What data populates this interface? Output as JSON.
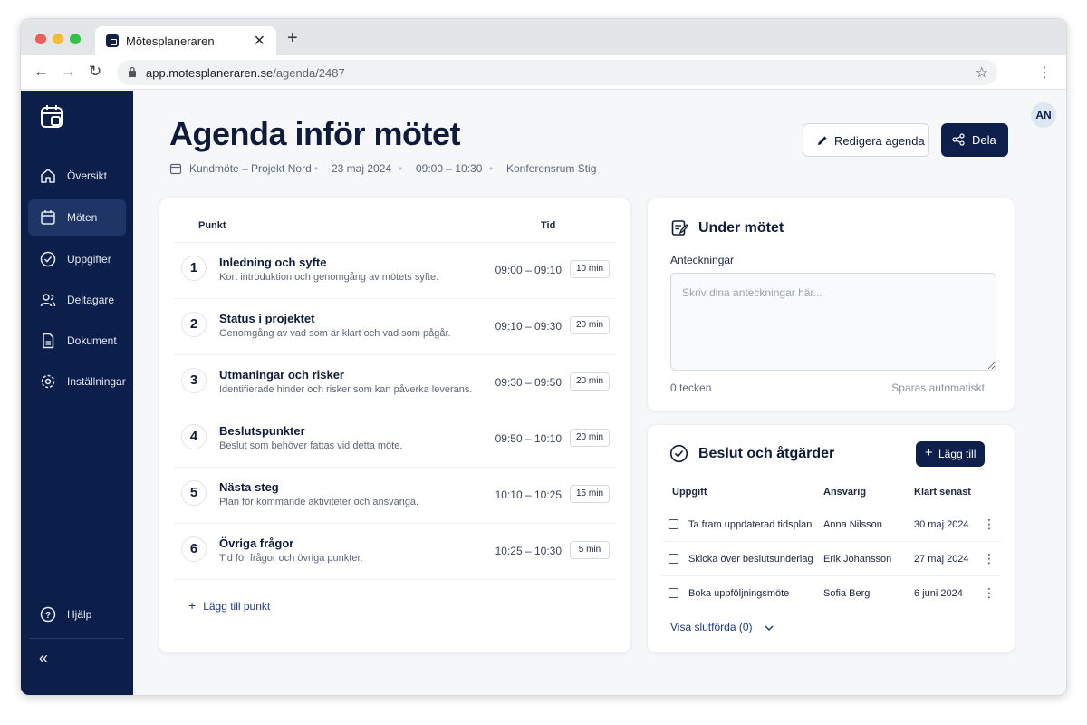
{
  "browser": {
    "tab_title": "Mötesplaneraren",
    "tab_close": "✕",
    "new_tab": "+",
    "back": "←",
    "forward": "→",
    "reload": "↻",
    "url_host": "app.motesplaneraren.se",
    "url_path": "/agenda/2487",
    "star": "☆",
    "menu": "⋮"
  },
  "sidebar": {
    "items": [
      {
        "label": "Översikt",
        "icon": "home-icon"
      },
      {
        "label": "Möten",
        "icon": "calendar-icon",
        "active": true
      },
      {
        "label": "Uppgifter",
        "icon": "check-circle-icon"
      },
      {
        "label": "Deltagare",
        "icon": "users-icon"
      },
      {
        "label": "Dokument",
        "icon": "document-icon"
      },
      {
        "label": "Inställningar",
        "icon": "gear-icon"
      }
    ],
    "help": "Hjälp",
    "collapse": "«"
  },
  "user": {
    "initials": "AN"
  },
  "header": {
    "title": "Agenda inför mötet",
    "meeting_name": "Kundmöte – Projekt Nord",
    "date": "23 maj 2024",
    "time": "09:00 – 10:30",
    "room": "Konferensrum Stig",
    "edit_label": "Redigera agenda",
    "share_label": "Dela"
  },
  "agenda": {
    "col_point": "Punkt",
    "col_time": "Tid",
    "items": [
      {
        "num": "1",
        "title": "Inledning och syfte",
        "desc": "Kort introduktion och genomgång av mötets syfte.",
        "time": "09:00 – 09:10",
        "duration": "10 min"
      },
      {
        "num": "2",
        "title": "Status i projektet",
        "desc": "Genomgång av vad som är klart och vad som pågår.",
        "time": "09:10 – 09:30",
        "duration": "20 min"
      },
      {
        "num": "3",
        "title": "Utmaningar och risker",
        "desc": "Identifierade hinder och risker som kan påverka leverans.",
        "time": "09:30 – 09:50",
        "duration": "20 min"
      },
      {
        "num": "4",
        "title": "Beslutspunkter",
        "desc": "Beslut som behöver fattas vid detta möte.",
        "time": "09:50 – 10:10",
        "duration": "20 min"
      },
      {
        "num": "5",
        "title": "Nästa steg",
        "desc": "Plan för kommande aktiviteter och ansvariga.",
        "time": "10:10 – 10:25",
        "duration": "15 min"
      },
      {
        "num": "6",
        "title": "Övriga frågor",
        "desc": "Tid för frågor och övriga punkter.",
        "time": "10:25 – 10:30",
        "duration": "5 min"
      }
    ],
    "add_point": "Lägg till punkt"
  },
  "notes": {
    "title": "Under mötet",
    "label": "Anteckningar",
    "placeholder": "Skriv dina anteckningar här...",
    "value": "",
    "char_count": "0 tecken",
    "autosave": "Sparas automatiskt"
  },
  "decisions": {
    "title": "Beslut och åtgärder",
    "add_label": "Lägg till",
    "col_task": "Uppgift",
    "col_owner": "Ansvarig",
    "col_due": "Klart senast",
    "rows": [
      {
        "task": "Ta fram uppdaterad tidsplan",
        "owner": "Anna Nilsson",
        "due": "30 maj 2024",
        "done": false
      },
      {
        "task": "Skicka över beslutsunderlag",
        "owner": "Erik Johansson",
        "due": "27 maj 2024",
        "done": false
      },
      {
        "task": "Boka uppföljningsmöte",
        "owner": "Sofia Berg",
        "due": "6 juni 2024",
        "done": false
      }
    ],
    "show_done": "Visa slutförda (0)"
  },
  "colors": {
    "sidebar_bg": "#0b1f4a",
    "primary": "#0e1f4b",
    "link": "#1c3a88",
    "page_bg": "#f6f7f9"
  }
}
